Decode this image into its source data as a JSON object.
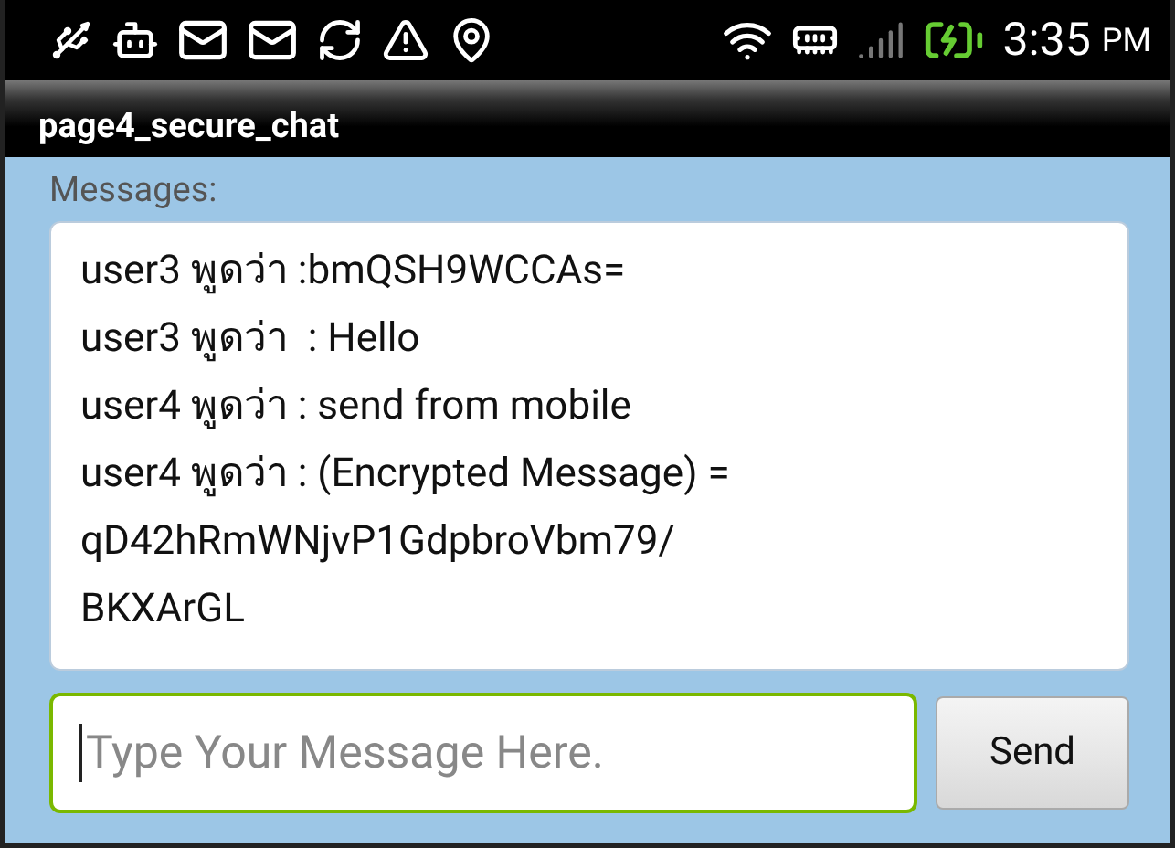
{
  "status_bar": {
    "time": "3:35",
    "meridiem": "PM"
  },
  "title_bar": {
    "title": "page4_secure_chat"
  },
  "messages_label": "Messages:",
  "message_lines": [
    "user3 พูดว่า :bmQSH9WCCAs=",
    "user3 พูดว่า  : Hello",
    "user4 พูดว่า : send from mobile",
    "user4 พูดว่า : (Encrypted Message) =",
    "qD42hRmWNjvP1GdpbroVbm79/",
    "BKXArGL"
  ],
  "composer": {
    "placeholder": "Type Your Message Here.",
    "focused": true,
    "send_label": "Send"
  }
}
